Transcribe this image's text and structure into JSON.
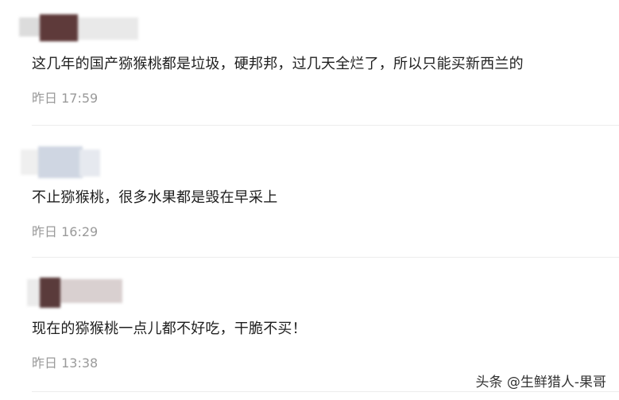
{
  "comments": [
    {
      "text": "这几年的国产猕猴桃都是垃圾，硬邦邦，过几天全烂了，所以只能买新西兰的",
      "time": "昨日 17:59",
      "avatar_colors": [
        "#dcdcdc",
        "#5e3a3a",
        "#e9e9e9"
      ]
    },
    {
      "text": "不止猕猴桃，很多水果都是毁在早采上",
      "time": "昨日 16:29",
      "avatar_colors": [
        "#e6e9ef",
        "#cfd6e2",
        "#efefef"
      ]
    },
    {
      "text": "现在的猕猴桃一点儿都不好吃，干脆不买！",
      "time": "昨日 13:38",
      "avatar_colors": [
        "#d9d0d0",
        "#5a3b3b",
        "#ebebeb"
      ]
    }
  ],
  "watermark": "头条 @生鲜猎人-果哥"
}
